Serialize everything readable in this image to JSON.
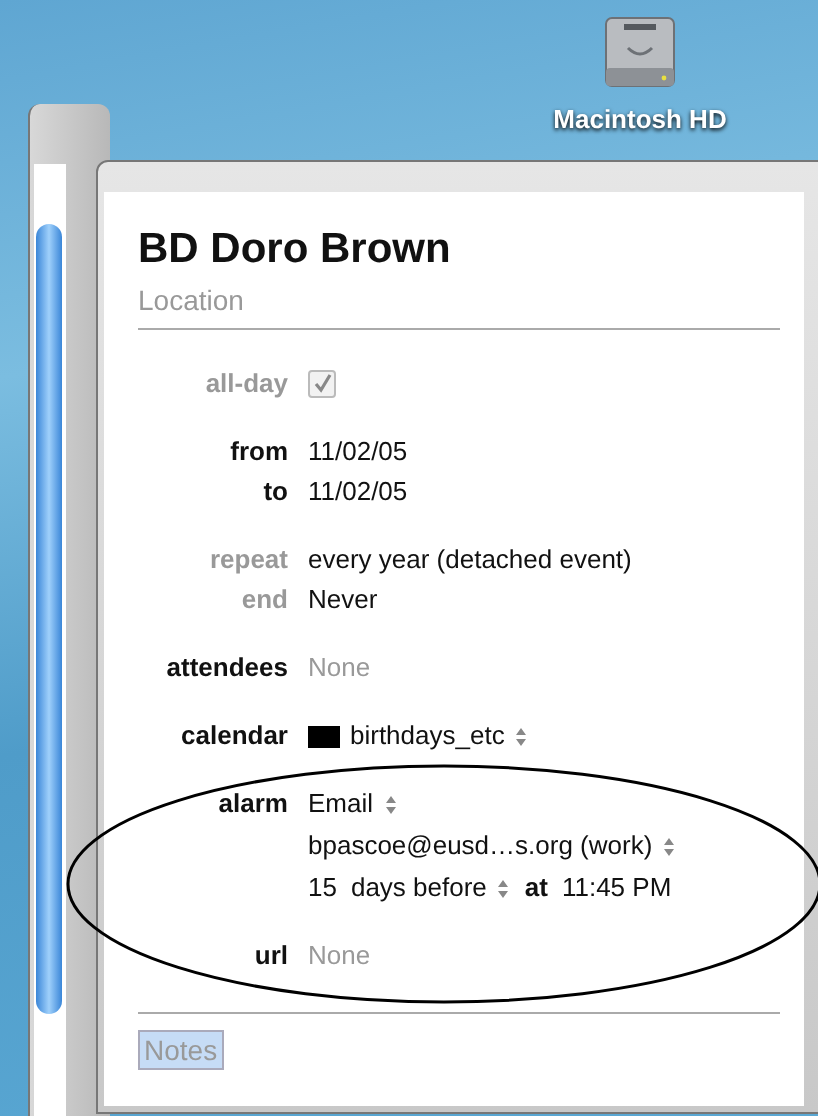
{
  "desktop": {
    "drive_label": "Macintosh HD"
  },
  "event": {
    "title": "BD Doro Brown",
    "location_placeholder": "Location",
    "groups": [
      {
        "rows": [
          {
            "kind": "checkbox",
            "label": "all-day",
            "label_dimmed": true,
            "checked": true
          }
        ]
      },
      {
        "rows": [
          {
            "kind": "text",
            "label": "from",
            "label_dimmed": false,
            "value": "11/02/05",
            "value_dimmed": false
          },
          {
            "kind": "text",
            "label": "to",
            "label_dimmed": false,
            "value": "11/02/05",
            "value_dimmed": false
          }
        ]
      },
      {
        "rows": [
          {
            "kind": "text",
            "label": "repeat",
            "label_dimmed": true,
            "value": "every year (detached event)",
            "value_dimmed": false
          },
          {
            "kind": "text",
            "label": "end",
            "label_dimmed": true,
            "value": "Never",
            "value_dimmed": false
          }
        ]
      },
      {
        "rows": [
          {
            "kind": "text",
            "label": "attendees",
            "label_dimmed": false,
            "value": "None",
            "value_dimmed": true
          }
        ]
      },
      {
        "rows": [
          {
            "kind": "popup",
            "label": "calendar",
            "label_dimmed": false,
            "value": "birthdays_etc",
            "color": "#000000"
          }
        ]
      },
      {
        "rows": [
          {
            "kind": "alarm",
            "label": "alarm",
            "label_dimmed": false,
            "lines": [
              [
                {
                  "text": "Email",
                  "popup": true,
                  "bold": false
                }
              ],
              [
                {
                  "text": "bpascoe@eusd…s.org (work)",
                  "popup": true,
                  "bold": false
                }
              ],
              [
                {
                  "text": "15",
                  "popup": false,
                  "bold": false
                },
                {
                  "text": "days before",
                  "popup": true,
                  "bold": false
                },
                {
                  "text": "at",
                  "popup": false,
                  "bold": true
                },
                {
                  "text": "11:45 PM",
                  "popup": false,
                  "bold": false
                }
              ]
            ]
          }
        ]
      },
      {
        "rows": [
          {
            "kind": "text",
            "label": "url",
            "label_dimmed": false,
            "value": "None",
            "value_dimmed": true
          }
        ]
      }
    ],
    "notes": {
      "placeholder": "Notes",
      "selected": true
    }
  }
}
